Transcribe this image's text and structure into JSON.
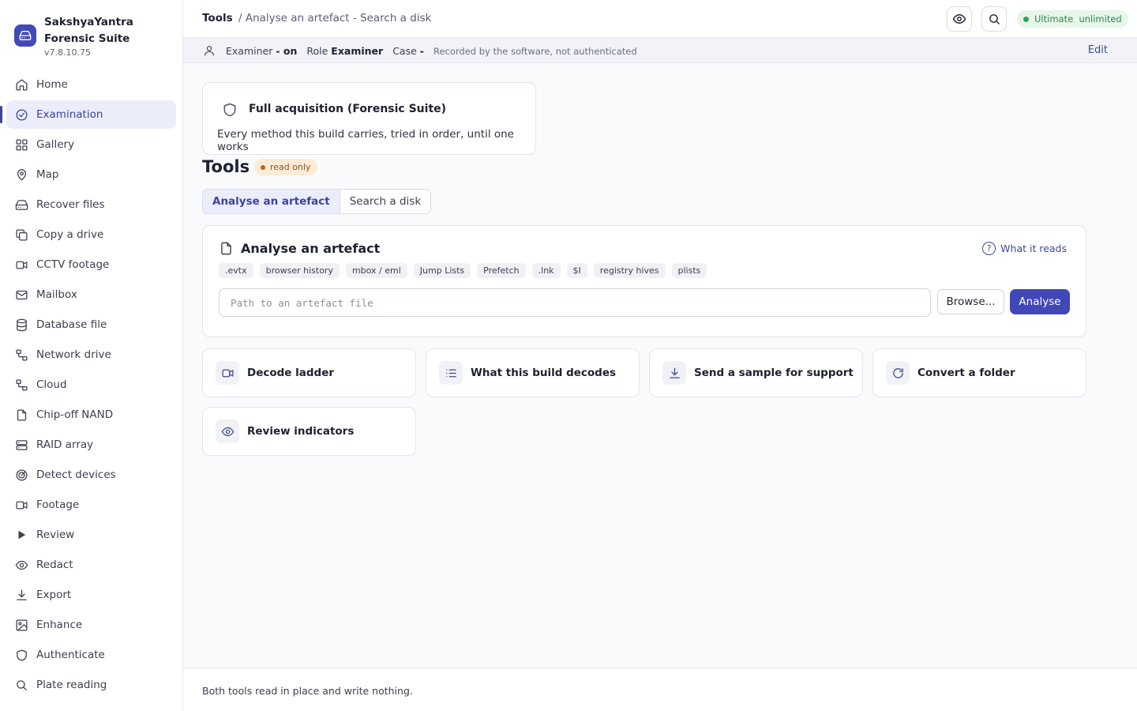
{
  "app": {
    "name": "SakshyaYantra Forensic Suite",
    "version": "v7.8.10.75",
    "accent": "#4047b7"
  },
  "sidebar": {
    "items": [
      {
        "label": "Home",
        "icon": "home-icon"
      },
      {
        "label": "Examination",
        "icon": "check-circle-icon",
        "active": true
      },
      {
        "label": "Gallery",
        "icon": "grid-icon"
      },
      {
        "label": "Map",
        "icon": "map-pin-icon"
      },
      {
        "label": "Recover files",
        "icon": "hard-drive-icon"
      },
      {
        "label": "Copy a drive",
        "icon": "copy-icon"
      },
      {
        "label": "CCTV footage",
        "icon": "video-icon"
      },
      {
        "label": "Mailbox",
        "icon": "mail-icon"
      },
      {
        "label": "Database file",
        "icon": "database-icon"
      },
      {
        "label": "Network drive",
        "icon": "network-icon"
      },
      {
        "label": "Cloud",
        "icon": "cloud-network-icon"
      },
      {
        "label": "Chip-off NAND",
        "icon": "file-icon"
      },
      {
        "label": "RAID array",
        "icon": "server-icon"
      },
      {
        "label": "Detect devices",
        "icon": "radar-icon"
      },
      {
        "label": "Footage",
        "icon": "video-icon"
      },
      {
        "label": "Review",
        "icon": "play-icon"
      },
      {
        "label": "Redact",
        "icon": "eye-icon"
      },
      {
        "label": "Export",
        "icon": "download-icon"
      },
      {
        "label": "Enhance",
        "icon": "image-icon"
      },
      {
        "label": "Authenticate",
        "icon": "shield-icon"
      },
      {
        "label": "Plate reading",
        "icon": "search-icon"
      }
    ]
  },
  "header": {
    "breadcrumb_root": "Tools",
    "breadcrumb_rest": "/ Analyse an artefact - Search a disk",
    "license": "Ultimate  unlimited"
  },
  "examiner": {
    "examiner_label": "Examiner",
    "examiner_value": "- on",
    "role_label": "Role",
    "role_value": "Examiner",
    "case_label": "Case",
    "case_value": "-",
    "note": "Recorded by the software, not authenticated",
    "edit": "Edit"
  },
  "acquisition": {
    "title": "Full acquisition (Forensic Suite)",
    "description": "Every method this build carries, tried in order, until one works"
  },
  "page": {
    "title": "Tools",
    "badge": "read only"
  },
  "tabs": [
    {
      "label": "Analyse an artefact",
      "active": true
    },
    {
      "label": "Search a disk",
      "active": false
    }
  ],
  "artefact": {
    "title": "Analyse an artefact",
    "what_it_reads": "What it reads",
    "chips": [
      ".evtx",
      "browser history",
      "mbox / eml",
      "Jump Lists",
      "Prefetch",
      ".lnk",
      "$I",
      "registry hives",
      "plists"
    ],
    "input_value": "",
    "input_placeholder": "Path to an artefact file",
    "browse": "Browse...",
    "analyse": "Analyse"
  },
  "tools": [
    {
      "label": "Decode ladder",
      "icon": "video-icon"
    },
    {
      "label": "What this build decodes",
      "icon": "list-icon"
    },
    {
      "label": "Send a sample for support",
      "icon": "download-icon"
    },
    {
      "label": "Convert a folder",
      "icon": "refresh-icon"
    },
    {
      "label": "Review indicators",
      "icon": "eye-icon"
    }
  ],
  "footer": {
    "text": "Both tools read in place and write nothing."
  }
}
